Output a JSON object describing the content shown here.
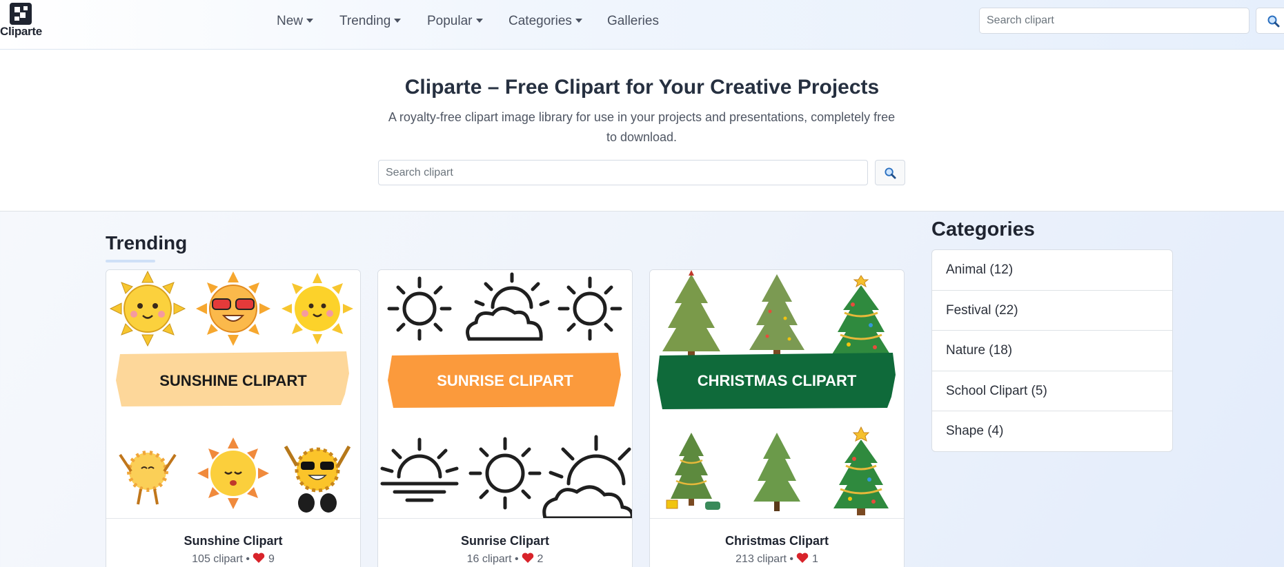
{
  "brand": {
    "name": "Cliparte"
  },
  "nav": {
    "items": [
      {
        "label": "New",
        "dropdown": true
      },
      {
        "label": "Trending",
        "dropdown": true
      },
      {
        "label": "Popular",
        "dropdown": true
      },
      {
        "label": "Categories",
        "dropdown": true
      },
      {
        "label": "Galleries",
        "dropdown": false
      }
    ],
    "search_placeholder": "Search clipart"
  },
  "hero": {
    "title": "Cliparte – Free Clipart for Your Creative Projects",
    "subtitle": "A royalty-free clipart image library for use in your projects and presentations, completely free to download.",
    "search_placeholder": "Search clipart"
  },
  "trending": {
    "heading": "Trending",
    "cards": [
      {
        "banner": "SUNSHINE CLIPART",
        "title": "Sunshine Clipart",
        "count": "105 clipart",
        "likes": "9"
      },
      {
        "banner": "SUNRISE CLIPART",
        "title": "Sunrise Clipart",
        "count": "16 clipart",
        "likes": "2"
      },
      {
        "banner": "CHRISTMAS CLIPART",
        "title": "Christmas Clipart",
        "count": "213 clipart",
        "likes": "1"
      }
    ]
  },
  "categories": {
    "heading": "Categories",
    "items": [
      {
        "label": "Animal (12)"
      },
      {
        "label": "Festival (22)"
      },
      {
        "label": "Nature (18)"
      },
      {
        "label": "School Clipart (5)"
      },
      {
        "label": "Shape (4)"
      }
    ]
  },
  "colors": {
    "sunshine_banner": "#fdd79a",
    "sunrise_banner": "#fb9a3c",
    "christmas_banner": "#0f6a3a",
    "heart": "#d8232a"
  },
  "icons": {
    "search": "search-icon",
    "heart": "heart-icon",
    "caret": "chevron-down-icon"
  }
}
